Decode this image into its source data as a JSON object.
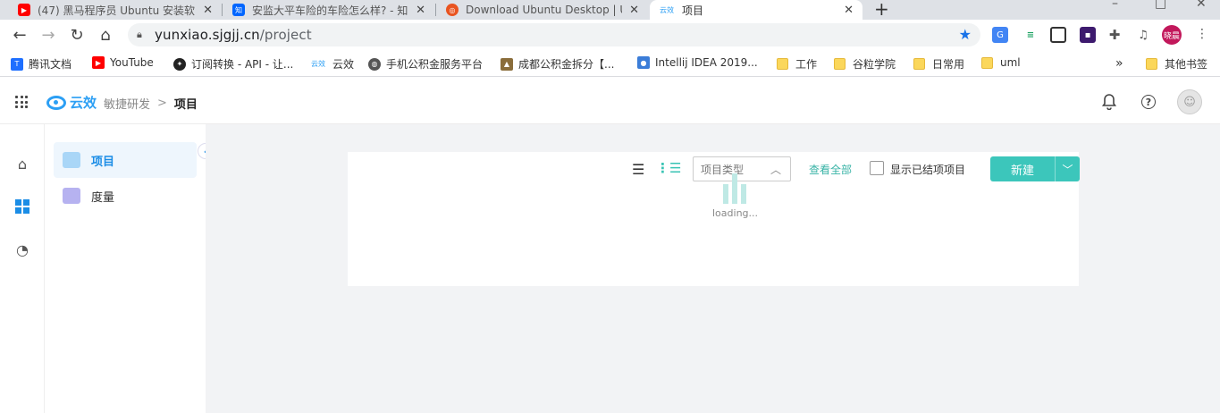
{
  "browser": {
    "tabs": [
      {
        "title": "(47) 黑马程序员 Ubuntu 安装软",
        "favicon": "youtube-icon",
        "favicon_color": "#ff0000"
      },
      {
        "title": "安监大平车险的车险怎么样? - 知",
        "favicon": "zhihu-icon",
        "favicon_color": "#0066ff"
      },
      {
        "title": "Download Ubuntu Desktop | U",
        "favicon": "ubuntu-icon",
        "favicon_color": "#e95420"
      },
      {
        "title": "项目",
        "favicon": "yunxiao-icon",
        "favicon_color": "#2c9ff4",
        "favicon_text": "云效"
      }
    ],
    "new_tab": "+",
    "url_host": "yunxiao.sjgjj.cn",
    "url_path": "/project",
    "profile_name": "晓晨",
    "bookmarks": [
      {
        "label": "腾讯文档",
        "icon": "tencent-docs-icon",
        "color": "#1e6fff"
      },
      {
        "label": "YouTube",
        "icon": "youtube-icon",
        "color": "#ff0000"
      },
      {
        "label": "订阅转换 - API - 让...",
        "icon": "api-icon",
        "color": "#222222"
      },
      {
        "label": "云效",
        "icon": "yunxiao-icon",
        "color": "#2c9ff4"
      },
      {
        "label": "手机公积金服务平台",
        "icon": "globe-icon",
        "color": "#555555"
      },
      {
        "label": "成都公积金拆分【...",
        "icon": "chart-icon",
        "color": "#8a6d3b"
      },
      {
        "label": "Intellij IDEA 2019...",
        "icon": "location-icon",
        "color": "#3b7dd8"
      },
      {
        "label": "工作",
        "icon": "folder-icon"
      },
      {
        "label": "谷粒学院",
        "icon": "folder-icon"
      },
      {
        "label": "日常用",
        "icon": "folder-icon"
      },
      {
        "label": "uml",
        "icon": "folder-icon"
      },
      {
        "label": "其他书签",
        "icon": "folder-icon"
      }
    ],
    "more_bookmarks": "»"
  },
  "app": {
    "brand": "云效",
    "breadcrumb_parent": "敏捷研发",
    "breadcrumb_sep": ">",
    "breadcrumb_current": "项目",
    "help_glyph": "?"
  },
  "sidebar": {
    "items": [
      {
        "label": "项目",
        "active": true
      },
      {
        "label": "度量",
        "active": false
      }
    ]
  },
  "toolbar": {
    "type_placeholder": "项目类型",
    "view_all": "查看全部",
    "show_closed_label": "显示已结项项目",
    "show_closed_checked": false,
    "new_label": "新建"
  },
  "content": {
    "loading_text": "loading..."
  },
  "colors": {
    "accent": "#3cc6bb",
    "brand_blue": "#2c9ff4",
    "nav_active": "#1b8de6"
  }
}
